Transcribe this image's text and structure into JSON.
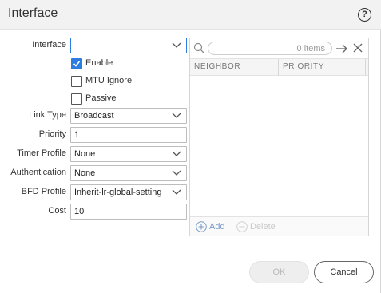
{
  "dialog": {
    "title": "Interface",
    "help_glyph": "?"
  },
  "form": {
    "interface": {
      "label": "Interface",
      "value": ""
    },
    "enable": {
      "label": "Enable",
      "checked": true
    },
    "mtu_ignore": {
      "label": "MTU Ignore",
      "checked": false
    },
    "passive": {
      "label": "Passive",
      "checked": false
    },
    "link_type": {
      "label": "Link Type",
      "value": "Broadcast"
    },
    "priority": {
      "label": "Priority",
      "value": "1"
    },
    "timer_profile": {
      "label": "Timer Profile",
      "value": "None"
    },
    "authentication": {
      "label": "Authentication",
      "value": "None"
    },
    "bfd_profile": {
      "label": "BFD Profile",
      "value": "Inherit-lr-global-setting"
    },
    "cost": {
      "label": "Cost",
      "value": "10"
    }
  },
  "neighbor_grid": {
    "items_count": "0 items",
    "columns": [
      "NEIGHBOR",
      "PRIORITY"
    ],
    "rows": [],
    "add_label": "Add",
    "delete_label": "Delete"
  },
  "buttons": {
    "ok": "OK",
    "cancel": "Cancel"
  },
  "icons": {
    "help": "help-icon",
    "search": "search-icon",
    "apply_filter": "arrow-right-icon",
    "clear_filter": "close-icon",
    "add": "plus-circle-icon",
    "delete": "minus-circle-icon",
    "dropdown": "chevron-down-icon",
    "check": "check-icon"
  },
  "colors": {
    "accent": "#2b7de1",
    "add_link": "#7a9cc6",
    "disabled_text": "#c9c9c9"
  }
}
